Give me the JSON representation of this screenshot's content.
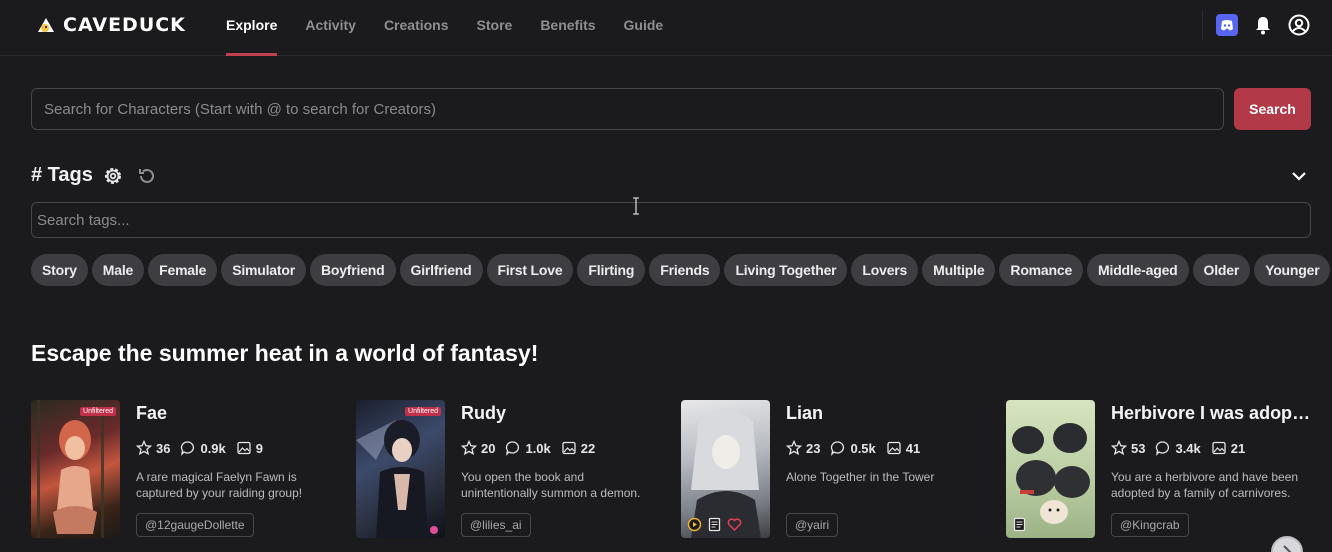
{
  "nav": {
    "logo_text": "CAVEDUCK",
    "items": [
      {
        "label": "Explore",
        "active": true
      },
      {
        "label": "Activity",
        "active": false
      },
      {
        "label": "Creations",
        "active": false
      },
      {
        "label": "Store",
        "active": false
      },
      {
        "label": "Benefits",
        "active": false
      },
      {
        "label": "Guide",
        "active": false
      }
    ],
    "icons": [
      "discord-icon",
      "bell-icon",
      "user-circle-icon"
    ]
  },
  "search": {
    "placeholder": "Search for Characters (Start with @ to search for Creators)",
    "button_label": "Search"
  },
  "tags": {
    "title": "# Tags",
    "search_placeholder": "Search tags...",
    "items": [
      "Story",
      "Male",
      "Female",
      "Simulator",
      "Boyfriend",
      "Girlfriend",
      "First Love",
      "Flirting",
      "Friends",
      "Living Together",
      "Lovers",
      "Multiple",
      "Romance",
      "Middle-aged",
      "Older",
      "Younger"
    ]
  },
  "section": {
    "title": "Escape the summer heat in a world of fantasy!"
  },
  "cards": [
    {
      "name": "Fae",
      "badge": "Unfiltered",
      "stars": "36",
      "chats": "0.9k",
      "images": "9",
      "description": "A rare magical Faelyn Fawn is captured by your raiding group!",
      "creator": "@12gaugeDollette"
    },
    {
      "name": "Rudy",
      "badge": "Unfiltered",
      "stars": "20",
      "chats": "1.0k",
      "images": "22",
      "description": "You open the book and unintentionally summon a demon.",
      "creator": "@lilies_ai"
    },
    {
      "name": "Lian",
      "badge": "",
      "stars": "23",
      "chats": "0.5k",
      "images": "41",
      "description": "Alone Together in the Tower",
      "creator": "@yairi"
    },
    {
      "name": "Herbivore I was adopted by a family of carnivores",
      "badge": "",
      "stars": "53",
      "chats": "3.4k",
      "images": "21",
      "description": "You are a herbivore and have been adopted by a family of carnivores.",
      "creator": "@Kingcrab"
    }
  ],
  "colors": {
    "background": "#1b1b1d",
    "accent": "#b23a48",
    "chip": "#3d3d42"
  }
}
